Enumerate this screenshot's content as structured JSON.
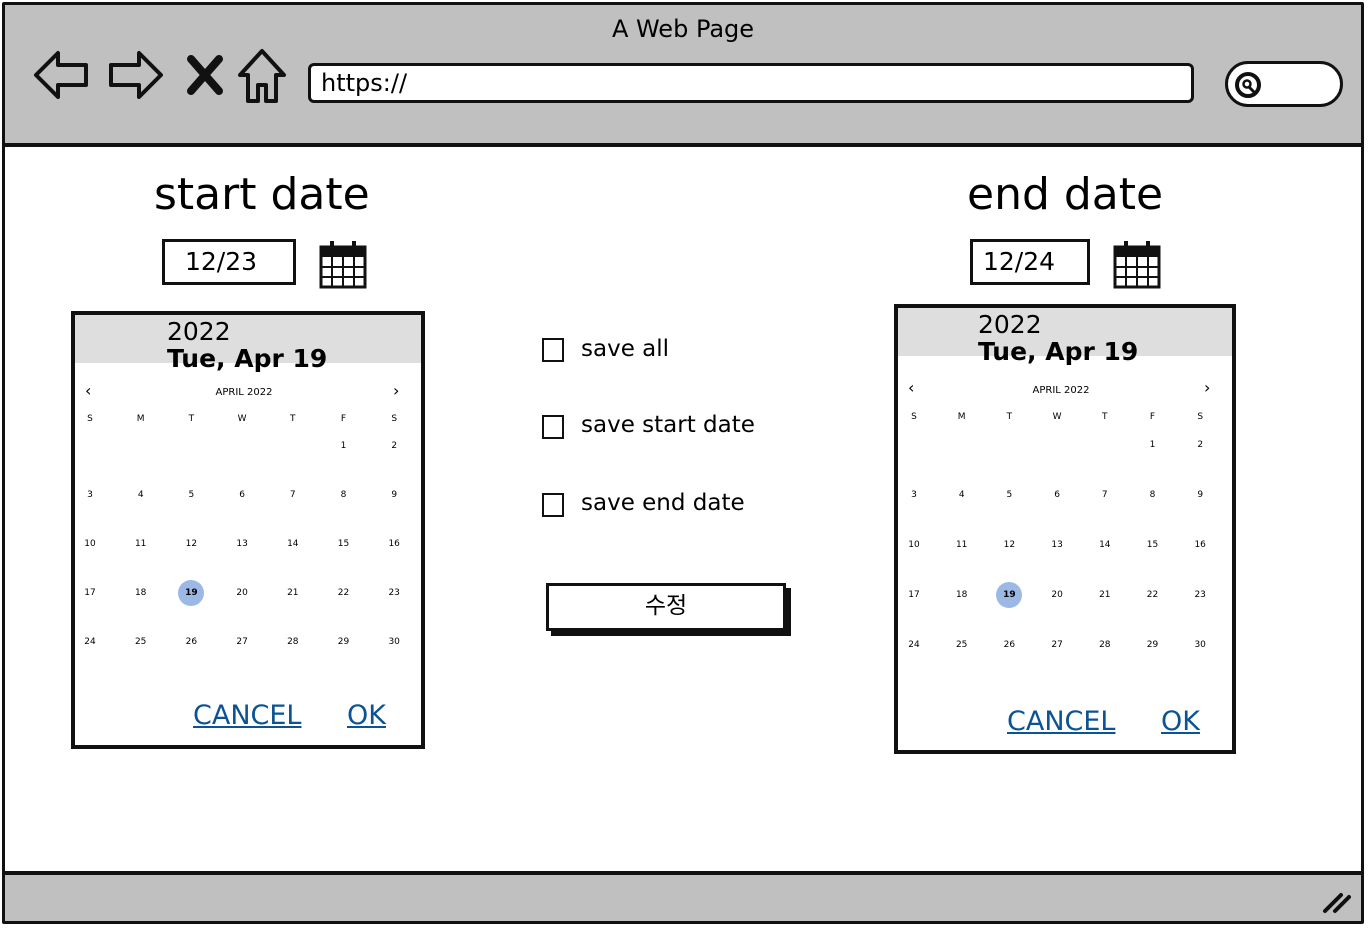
{
  "window": {
    "title": "A Web Page"
  },
  "browser": {
    "url": "https://",
    "back_icon": "arrow-left-icon",
    "forward_icon": "arrow-right-icon",
    "stop_icon": "close-icon",
    "home_icon": "home-icon",
    "search_icon": "search-icon"
  },
  "start": {
    "heading": "start date",
    "input_value": "12/23",
    "picker": {
      "year": "2022",
      "date": "Tue, Apr 19",
      "month": "APRIL 2022",
      "weekdays": [
        "S",
        "M",
        "T",
        "W",
        "T",
        "F",
        "S"
      ],
      "weeks": [
        [
          "",
          "",
          "",
          "",
          "",
          "1",
          "2"
        ],
        [
          "3",
          "4",
          "5",
          "6",
          "7",
          "8",
          "9"
        ],
        [
          "10",
          "11",
          "12",
          "13",
          "14",
          "15",
          "16"
        ],
        [
          "17",
          "18",
          "19",
          "20",
          "21",
          "22",
          "23"
        ],
        [
          "24",
          "25",
          "26",
          "27",
          "28",
          "29",
          "30"
        ]
      ],
      "selected": "19",
      "cancel": "CANCEL",
      "ok": "OK"
    }
  },
  "end": {
    "heading": "end date",
    "input_value": "12/24",
    "picker": {
      "year": "2022",
      "date": "Tue, Apr 19",
      "month": "APRIL 2022",
      "weekdays": [
        "S",
        "M",
        "T",
        "W",
        "T",
        "F",
        "S"
      ],
      "weeks": [
        [
          "",
          "",
          "",
          "",
          "",
          "1",
          "2"
        ],
        [
          "3",
          "4",
          "5",
          "6",
          "7",
          "8",
          "9"
        ],
        [
          "10",
          "11",
          "12",
          "13",
          "14",
          "15",
          "16"
        ],
        [
          "17",
          "18",
          "19",
          "20",
          "21",
          "22",
          "23"
        ],
        [
          "24",
          "25",
          "26",
          "27",
          "28",
          "29",
          "30"
        ]
      ],
      "selected": "19",
      "cancel": "CANCEL",
      "ok": "OK"
    }
  },
  "options": {
    "save_all": "save all",
    "save_start": "save start date",
    "save_end": "save end date",
    "submit": "수정"
  }
}
